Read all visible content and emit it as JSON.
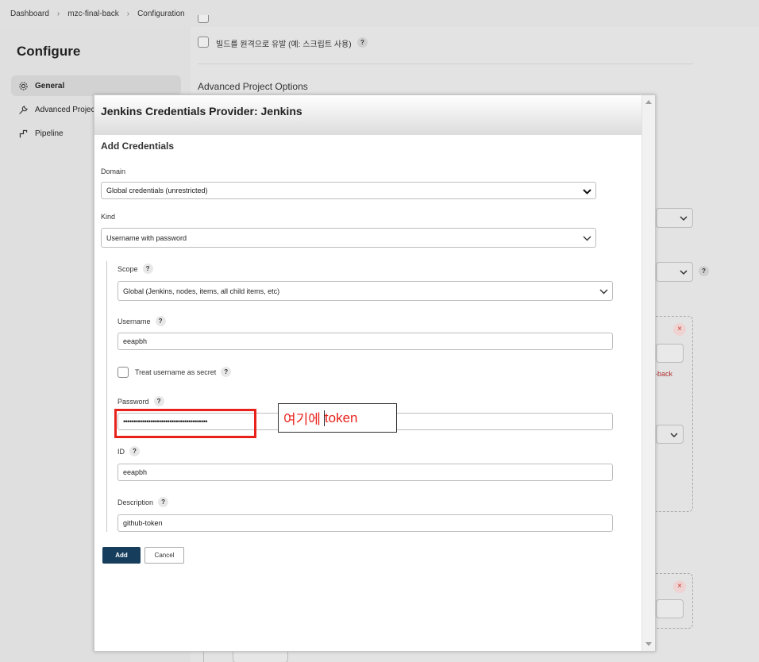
{
  "breadcrumb": [
    "Dashboard",
    "mzc-final-back",
    "Configuration"
  ],
  "configure": {
    "title": "Configure",
    "sidebar": [
      {
        "label": "General",
        "icon": "gear-icon",
        "active": true
      },
      {
        "label": "Advanced Project",
        "icon": "wrench-icon",
        "active": false
      },
      {
        "label": "Pipeline",
        "icon": "pipeline-icon",
        "active": false
      }
    ]
  },
  "background": {
    "remote_trigger_label": "빌드를 원격으로 유발 (예: 스크립트 사용)",
    "advanced_options_title": "Advanced Project Options",
    "back_fragment": "-back",
    "remove_symbol": "×",
    "help_symbol": "?"
  },
  "modal": {
    "title": "Jenkins Credentials Provider: Jenkins",
    "section_title": "Add Credentials",
    "domain": {
      "label": "Domain",
      "value": "Global credentials (unrestricted)"
    },
    "kind": {
      "label": "Kind",
      "value": "Username with password"
    },
    "scope": {
      "label": "Scope",
      "value": "Global (Jenkins, nodes, items, all child items, etc)"
    },
    "username": {
      "label": "Username",
      "value": "eeapbh"
    },
    "treat_secret": {
      "label": "Treat username as secret",
      "checked": false
    },
    "password": {
      "label": "Password",
      "value": "••••••••••••••••••••••••••••••••••••••••"
    },
    "id": {
      "label": "ID",
      "value": "eeapbh"
    },
    "description": {
      "label": "Description",
      "value": "github-token"
    },
    "add_button": "Add",
    "cancel_button": "Cancel",
    "help_symbol": "?"
  },
  "annotation": {
    "text_before": "여기에",
    "text_after": "token",
    "color": "#e8221b"
  }
}
